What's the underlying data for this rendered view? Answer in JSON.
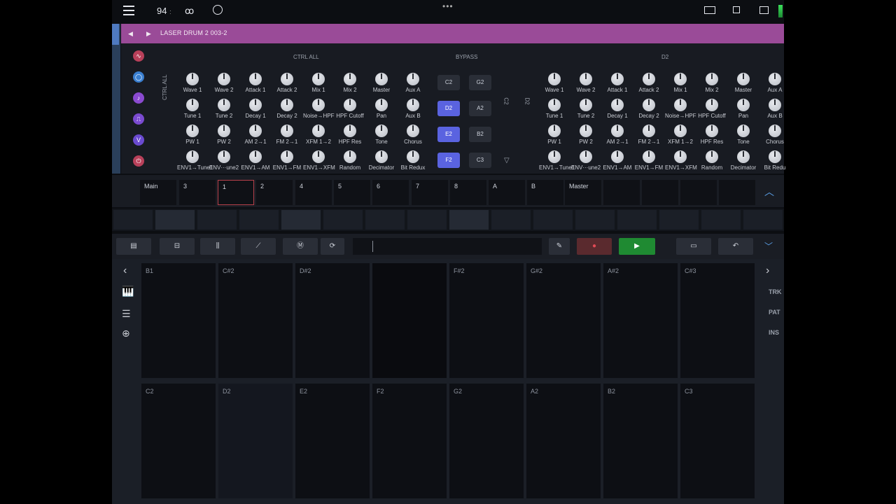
{
  "status": {
    "bpm": "94",
    "bpm_sep": ":",
    "tape_icon": "tape-icon",
    "clock_icon": "clock-icon",
    "menu_dots": "•••"
  },
  "instrument": {
    "title": "LASER DRUM 2 003-2"
  },
  "headers": {
    "ctrl_all": "CTRL ALL",
    "bypass": "BYPASS",
    "d2": "D2",
    "ctrl_all_vertical": "CTRL ALL",
    "c2_vertical": "C2",
    "d2_vertical": "D2"
  },
  "knob_rows_left": [
    [
      "Wave 1",
      "Wave 2",
      "Attack 1",
      "Attack 2",
      "Mix 1",
      "Mix 2",
      "Master",
      "Aux A"
    ],
    [
      "Tune 1",
      "Tune 2",
      "Decay 1",
      "Decay 2",
      "Noise→HPF",
      "HPF Cutoff",
      "Pan",
      "Aux B"
    ],
    [
      "PW 1",
      "PW 2",
      "AM 2→1",
      "FM 2→1",
      "XFM 1→2",
      "HPF Res",
      "Tone",
      "Chorus"
    ],
    [
      "ENV1→Tune1",
      "ENV···une2",
      "ENV1→AM",
      "ENV1→FM",
      "ENV1→XFM",
      "Random",
      "Decimator",
      "Bit Redux"
    ]
  ],
  "knob_rows_right": [
    [
      "Wave 1",
      "Wave 2",
      "Attack 1",
      "Attack 2",
      "Mix 1",
      "Mix 2",
      "Master",
      "Aux A"
    ],
    [
      "Tune 1",
      "Tune 2",
      "Decay 1",
      "Decay 2",
      "Noise→HPF",
      "HPF Cutoff",
      "Pan",
      "Aux B"
    ],
    [
      "PW 1",
      "PW 2",
      "AM 2→1",
      "FM 2→1",
      "XFM 1→2",
      "HPF Res",
      "Tone",
      "Chorus"
    ],
    [
      "ENV1→Tune1",
      "ENV···une2",
      "ENV1→AM",
      "ENV1→FM",
      "ENV1→XFM",
      "Random",
      "Decimator",
      "Bit Redu"
    ]
  ],
  "bypass_pads": [
    {
      "label": "C2",
      "on": false
    },
    {
      "label": "G2",
      "on": false
    },
    {
      "label": "D2",
      "on": true
    },
    {
      "label": "A2",
      "on": false
    },
    {
      "label": "E2",
      "on": true
    },
    {
      "label": "B2",
      "on": false
    },
    {
      "label": "F2",
      "on": true
    },
    {
      "label": "C3",
      "on": false
    }
  ],
  "tracks": [
    "Main",
    "3",
    "1",
    "2",
    "4",
    "5",
    "6",
    "7",
    "8",
    "A",
    "B",
    "Master"
  ],
  "selected_track": "1",
  "pads": [
    "B1",
    "C#2",
    "D#2",
    "",
    "F#2",
    "G#2",
    "A#2",
    "C#3",
    "C2",
    "D2",
    "E2",
    "F2",
    "G2",
    "A2",
    "B2",
    "C3"
  ],
  "right_labels": [
    "TRK",
    "PAT",
    "INS"
  ],
  "colors": {
    "accent": "#5a63e0",
    "title": "#9a4b98",
    "play": "#1f8a32",
    "record": "#e04a55"
  }
}
